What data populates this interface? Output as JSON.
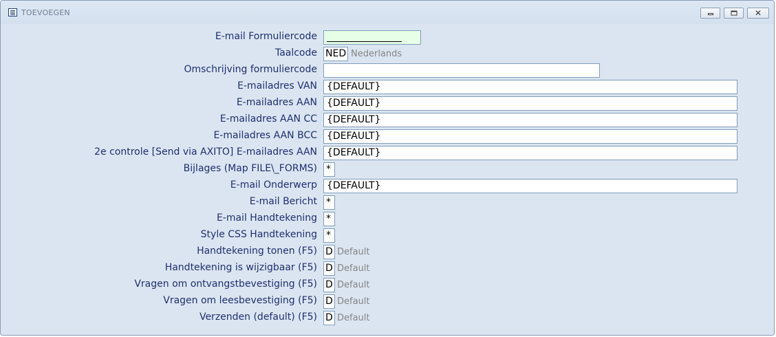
{
  "window": {
    "title": "TOEVOEGEN",
    "icon": "window-form-icon"
  },
  "fields": [
    {
      "label": "E-mail Formuliercode",
      "value": ""
    },
    {
      "label": "Taalcode",
      "value": "NED",
      "hint": "Nederlands"
    },
    {
      "label": "Omschrijving formuliercode",
      "value": ""
    },
    {
      "label": "E-mailadres VAN",
      "value": "{DEFAULT}"
    },
    {
      "label": "E-mailadres AAN",
      "value": "{DEFAULT}"
    },
    {
      "label": "E-mailadres AAN CC",
      "value": "{DEFAULT}"
    },
    {
      "label": "E-mailadres AAN BCC",
      "value": "{DEFAULT}"
    },
    {
      "label": "2e controle [Send via AXITO] E-mailadres AAN",
      "value": "{DEFAULT}"
    },
    {
      "label": "Bijlages (Map FILE\\_FORMS)",
      "value": "*"
    },
    {
      "label": "E-mail Onderwerp",
      "value": "{DEFAULT}"
    },
    {
      "label": "E-mail Bericht",
      "value": "*"
    },
    {
      "label": "E-mail Handtekening",
      "value": "*"
    },
    {
      "label": "Style CSS Handtekening",
      "value": "*"
    },
    {
      "label": "Handtekening tonen  (F5)",
      "value": "D",
      "hint": "Default"
    },
    {
      "label": "Handtekening is wijzigbaar  (F5)",
      "value": "D",
      "hint": "Default"
    },
    {
      "label": "Vragen om ontvangstbevestiging  (F5)",
      "value": "D",
      "hint": "Default"
    },
    {
      "label": "Vragen om leesbevestiging  (F5)",
      "value": "D",
      "hint": "Default"
    },
    {
      "label": "Verzenden (default)  (F5)",
      "value": "D",
      "hint": "Default"
    }
  ],
  "colors": {
    "background": "#dbe5f1",
    "label": "#1f2f6e",
    "input_border": "#7f9db9",
    "code_field": "#e6ffe6",
    "hint": "#858585"
  }
}
